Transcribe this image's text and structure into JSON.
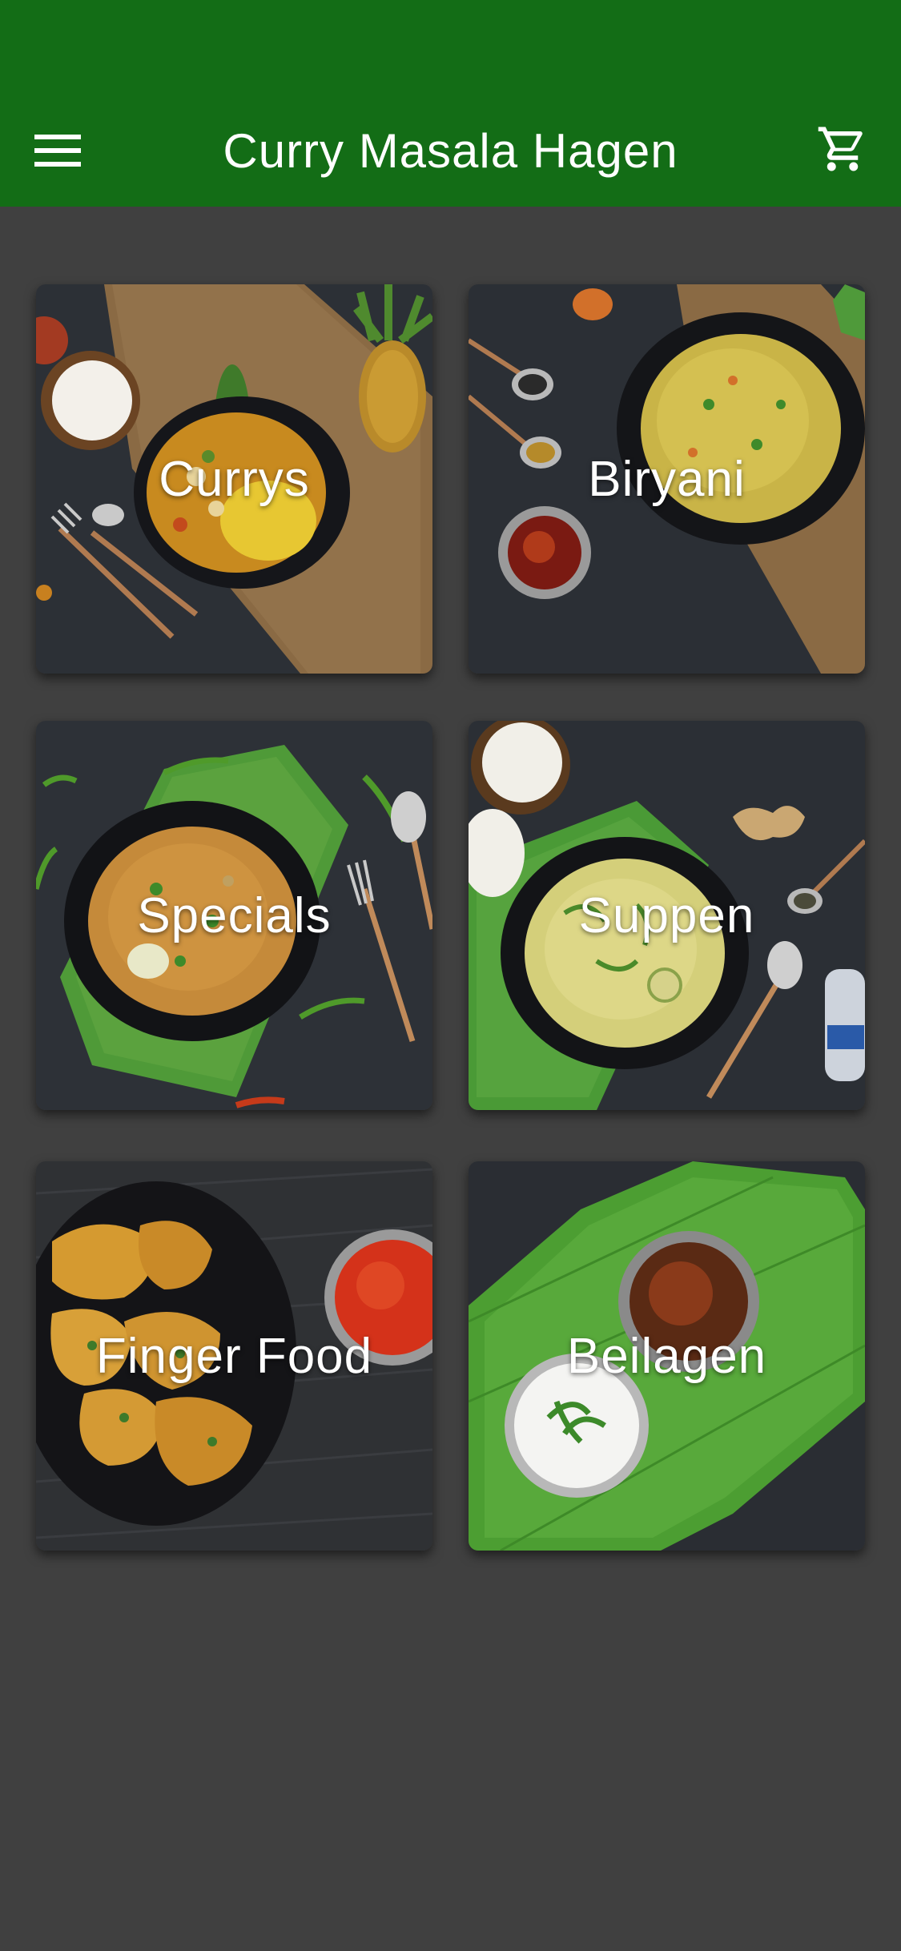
{
  "header": {
    "title": "Curry Masala Hagen",
    "menu_icon": "menu-icon",
    "cart_icon": "shopping-cart-icon",
    "background_color": "#136d16"
  },
  "categories": [
    {
      "label": "Currys"
    },
    {
      "label": "Biryani"
    },
    {
      "label": "Specials"
    },
    {
      "label": "Suppen"
    },
    {
      "label": "Finger Food"
    },
    {
      "label": "Beilagen"
    }
  ],
  "colors": {
    "page_background": "#404040",
    "text": "#ffffff"
  }
}
